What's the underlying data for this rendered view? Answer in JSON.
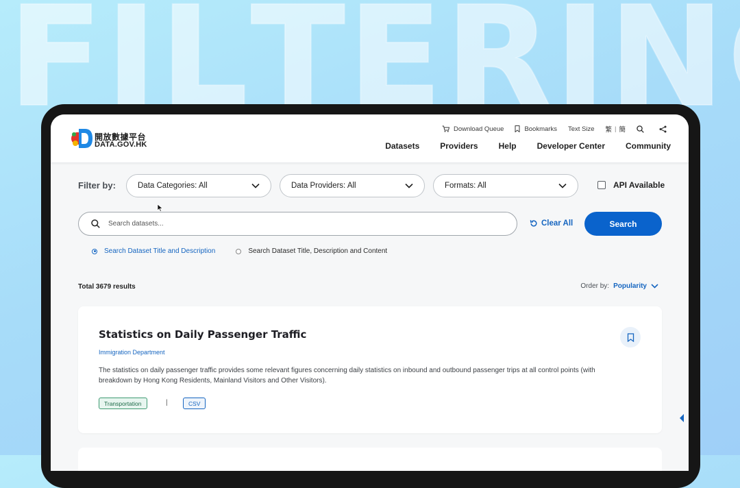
{
  "background_word": "FILTERING",
  "logo": {
    "chinese": "開放數據平台",
    "english": "DATA.GOV.HK"
  },
  "utility": {
    "download_queue": "Download Queue",
    "bookmarks": "Bookmarks",
    "text_size": "Text Size",
    "lang_trad": "繁",
    "lang_sep": "|",
    "lang_simp": "簡"
  },
  "nav": [
    "Datasets",
    "Providers",
    "Help",
    "Developer Center",
    "Community"
  ],
  "filter": {
    "label": "Filter by:",
    "categories": "Data Categories: All",
    "providers": "Data Providers: All",
    "formats": "Formats: All",
    "api_label": "API Available",
    "api_checked": false
  },
  "search": {
    "placeholder": "Search datasets...",
    "clear_label": "Clear All",
    "button_label": "Search",
    "options": [
      {
        "label": "Search Dataset Title and Description",
        "selected": true
      },
      {
        "label": "Search Dataset Title, Description and Content",
        "selected": false
      }
    ]
  },
  "results": {
    "total": "Total 3679 results",
    "order_label": "Order by:",
    "order_value": "Popularity"
  },
  "dataset": {
    "title": "Statistics on Daily Passenger Traffic",
    "provider": "Immigration Department",
    "description": "The statistics on daily passenger traffic provides some relevant figures concerning daily statistics on inbound and outbound passenger trips at all control points (with breakdown by Hong Kong Residents, Mainland Visitors and Other Visitors).",
    "category_tag": "Transportation",
    "tag_separator": "|",
    "format_tag": "CSV"
  },
  "colors": {
    "accent": "#0a63cc",
    "link": "#1565c0",
    "category_tag": "#3d9a71"
  }
}
